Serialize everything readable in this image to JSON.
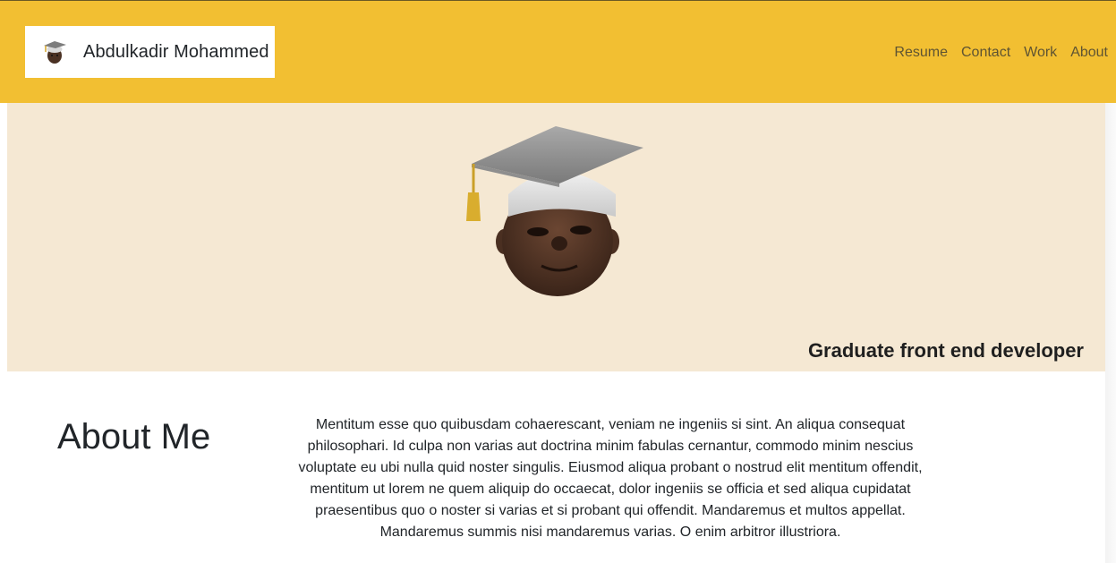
{
  "brand": {
    "name": "Abdulkadir Mohammed",
    "logo_icon": "graduate-avatar-icon"
  },
  "nav": {
    "items": [
      {
        "label": "Resume"
      },
      {
        "label": "Contact"
      },
      {
        "label": "Work"
      },
      {
        "label": "About"
      }
    ]
  },
  "hero": {
    "subtitle": "Graduate front end developer",
    "image_icon": "graduate-avatar-icon",
    "background": "#f5e8d3"
  },
  "about": {
    "title": "About Me",
    "body": "Mentitum esse quo quibusdam cohaerescant, veniam ne ingeniis si sint. An aliqua consequat philosophari. Id culpa non varias aut doctrina minim fabulas cernantur, commodo minim nescius voluptate eu ubi nulla quid noster singulis. Eiusmod aliqua probant o nostrud elit mentitum offendit, mentitum ut lorem ne quem aliquip do occaecat, dolor ingeniis se officia et sed aliqua cupidatat praesentibus quo o noster si varias et si probant qui offendit. Mandaremus et multos appellat. Mandaremus summis nisi mandaremus varias. O enim arbitror illustriora."
  },
  "colors": {
    "navbar": "#f2bf32",
    "nav_link": "#5f5432",
    "text": "#212529"
  }
}
